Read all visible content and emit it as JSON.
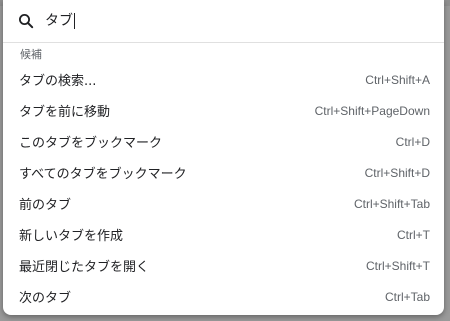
{
  "search": {
    "value": "タブ"
  },
  "section": {
    "label": "候補"
  },
  "commands": [
    {
      "label": "タブの検索...",
      "shortcut": "Ctrl+Shift+A"
    },
    {
      "label": "タブを前に移動",
      "shortcut": "Ctrl+Shift+PageDown"
    },
    {
      "label": "このタブをブックマーク",
      "shortcut": "Ctrl+D"
    },
    {
      "label": "すべてのタブをブックマーク",
      "shortcut": "Ctrl+Shift+D"
    },
    {
      "label": "前のタブ",
      "shortcut": "Ctrl+Shift+Tab"
    },
    {
      "label": "新しいタブを作成",
      "shortcut": "Ctrl+T"
    },
    {
      "label": "最近閉じたタブを開く",
      "shortcut": "Ctrl+Shift+T"
    },
    {
      "label": "次のタブ",
      "shortcut": "Ctrl+Tab"
    }
  ],
  "icons": {
    "search": "search-icon"
  }
}
